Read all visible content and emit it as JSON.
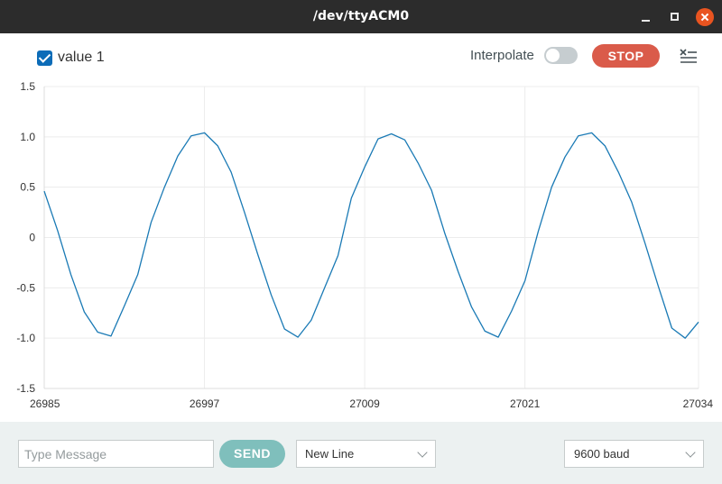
{
  "window": {
    "title": "/dev/ttyACM0"
  },
  "toolbar": {
    "series_label": "value 1",
    "interpolate_label": "Interpolate",
    "interpolate_on": false,
    "stop_label": "STOP"
  },
  "colors": {
    "line": "#1a7ab5",
    "stop": "#da5b4a",
    "send": "#7fbfbc",
    "checkbox": "#0c6cb8"
  },
  "chart_data": {
    "type": "line",
    "grid": true,
    "xlim": [
      26985,
      27034
    ],
    "ylim": [
      -1.5,
      1.5
    ],
    "x_ticks": [
      "26985",
      "26997",
      "27009",
      "27021",
      "27034"
    ],
    "y_ticks": [
      "1.5",
      "1.0",
      "0.5",
      "0",
      "-0.5",
      "-1.0",
      "-1.5"
    ],
    "series": [
      {
        "name": "value 1",
        "x": [
          26985,
          26986,
          26987,
          26988,
          26989,
          26990,
          26991,
          26992,
          26993,
          26994,
          26995,
          26996,
          26997,
          26998,
          26999,
          27000,
          27001,
          27002,
          27003,
          27004,
          27005,
          27006,
          27007,
          27008,
          27009,
          27010,
          27011,
          27012,
          27013,
          27014,
          27015,
          27016,
          27017,
          27018,
          27019,
          27020,
          27021,
          27022,
          27023,
          27024,
          27025,
          27026,
          27027,
          27028,
          27029,
          27030,
          27031,
          27032,
          27033,
          27034
        ],
        "values": [
          0.46,
          0.07,
          -0.37,
          -0.74,
          -0.94,
          -0.98,
          -0.68,
          -0.37,
          0.15,
          0.5,
          0.81,
          1.01,
          1.04,
          0.91,
          0.65,
          0.25,
          -0.17,
          -0.57,
          -0.91,
          -0.99,
          -0.82,
          -0.5,
          -0.18,
          0.39,
          0.7,
          0.98,
          1.03,
          0.97,
          0.74,
          0.47,
          0.04,
          -0.34,
          -0.69,
          -0.93,
          -0.99,
          -0.73,
          -0.43,
          0.06,
          0.5,
          0.8,
          1.01,
          1.04,
          0.91,
          0.65,
          0.35,
          -0.06,
          -0.49,
          -0.9,
          -1.0,
          -0.84
        ]
      }
    ]
  },
  "bottom": {
    "message_placeholder": "Type Message",
    "send_label": "SEND",
    "line_ending": "New Line",
    "baud_rate": "9600 baud"
  }
}
